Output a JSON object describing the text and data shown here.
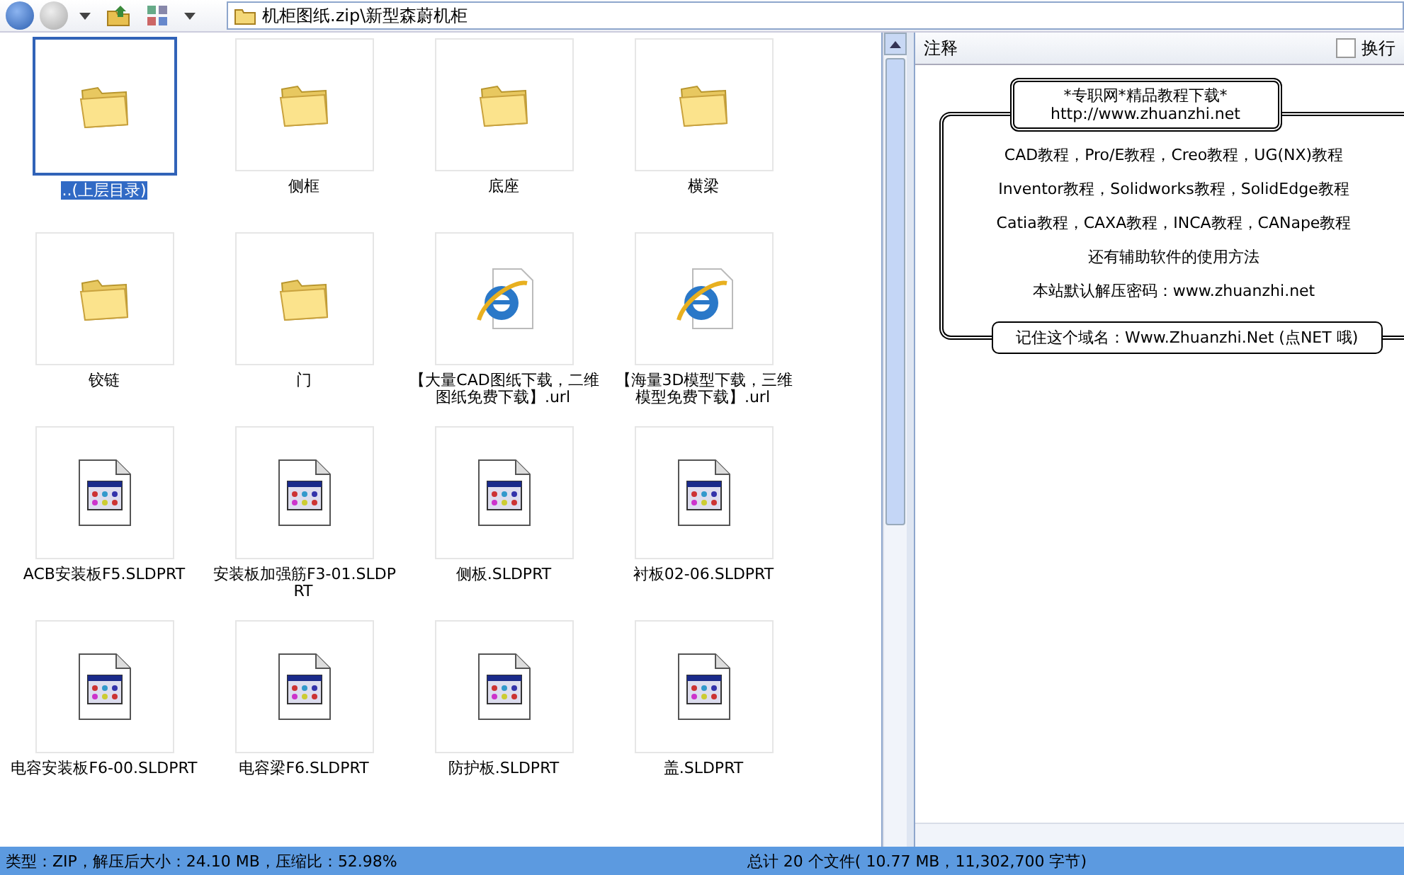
{
  "toolbar": {
    "path": "机柜图纸.zip\\新型森蔚机柜"
  },
  "items": [
    {
      "kind": "folder",
      "label": "..(上层目录)",
      "selected": true
    },
    {
      "kind": "folder",
      "label": "侧框",
      "selected": false
    },
    {
      "kind": "folder",
      "label": "底座",
      "selected": false
    },
    {
      "kind": "folder",
      "label": "横梁",
      "selected": false
    },
    {
      "kind": "folder",
      "label": "铰链",
      "selected": false
    },
    {
      "kind": "folder",
      "label": "门",
      "selected": false
    },
    {
      "kind": "url",
      "label": "【大量CAD图纸下载，二维图纸免费下载】.url",
      "selected": false
    },
    {
      "kind": "url",
      "label": "【海量3D模型下载，三维模型免费下载】.url",
      "selected": false
    },
    {
      "kind": "file",
      "label": "ACB安装板F5.SLDPRT",
      "selected": false
    },
    {
      "kind": "file",
      "label": "安装板加强筋F3-01.SLDPRT",
      "selected": false
    },
    {
      "kind": "file",
      "label": "侧板.SLDPRT",
      "selected": false
    },
    {
      "kind": "file",
      "label": "衬板02-06.SLDPRT",
      "selected": false
    },
    {
      "kind": "file",
      "label": "电容安装板F6-00.SLDPRT",
      "selected": false
    },
    {
      "kind": "file",
      "label": "电容梁F6.SLDPRT",
      "selected": false
    },
    {
      "kind": "file",
      "label": "防护板.SLDPRT",
      "selected": false
    },
    {
      "kind": "file",
      "label": "盖.SLDPRT",
      "selected": false
    }
  ],
  "comment_panel": {
    "title": "注释",
    "wrap_checkbox": {
      "label": "换行",
      "checked": false
    },
    "header_lines": [
      "*专职网*精品教程下载*",
      "http://www.zhuanzhi.net"
    ],
    "lines": [
      "CAD教程，Pro/E教程，Creo教程，UG(NX)教程",
      "Inventor教程，Solidworks教程，SolidEdge教程",
      "Catia教程，CAXA教程，INCA教程，CANape教程",
      "还有辅助软件的使用方法",
      "本站默认解压密码：www.zhuanzhi.net"
    ],
    "footer": "记住这个域名：Www.Zhuanzhi.Net (点NET 哦)"
  },
  "status_bar": {
    "left": "类型：ZIP，解压后大小：24.10 MB，压缩比：52.98%",
    "right": "总计 20 个文件( 10.77 MB，11,302,700 字节)"
  }
}
